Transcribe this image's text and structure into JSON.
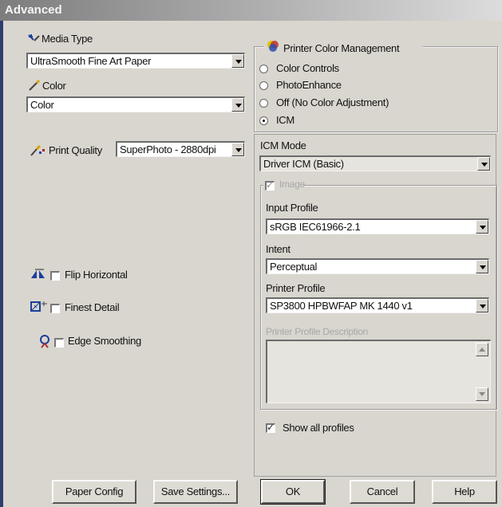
{
  "window": {
    "title": "Advanced"
  },
  "media_type": {
    "label": "Media Type",
    "value": "UltraSmooth Fine Art Paper",
    "icon": "media-type-icon"
  },
  "color": {
    "label": "Color",
    "value": "Color",
    "icon": "color-pen-icon"
  },
  "print_quality": {
    "label": "Print Quality",
    "value": "SuperPhoto - 2880dpi",
    "icon": "print-quality-icon"
  },
  "options": [
    {
      "label": "Flip Horizontal",
      "checked": false,
      "icon": "flip-horizontal-icon"
    },
    {
      "label": "Finest Detail",
      "checked": false,
      "icon": "finest-detail-icon"
    },
    {
      "label": "Edge Smoothing",
      "checked": false,
      "icon": "edge-smoothing-icon"
    }
  ],
  "color_management": {
    "title": "Printer Color Management",
    "options": [
      "Color Controls",
      "PhotoEnhance",
      "Off (No Color Adjustment)",
      "ICM"
    ],
    "selected": "ICM"
  },
  "icm": {
    "mode_label": "ICM Mode",
    "mode_value": "Driver ICM (Basic)",
    "image_label": "Image",
    "image_checked": true,
    "input_profile_label": "Input Profile",
    "input_profile_value": "sRGB IEC61966-2.1",
    "intent_label": "Intent",
    "intent_value": "Perceptual",
    "printer_profile_label": "Printer Profile",
    "printer_profile_value": "SP3800 HPBWFAP MK 1440 v1",
    "printer_profile_description_label": "Printer Profile Description",
    "show_all_profiles_label": "Show all profiles",
    "show_all_profiles_checked": true
  },
  "buttons": {
    "paper_config": "Paper Config",
    "save_settings": "Save Settings...",
    "ok": "OK",
    "cancel": "Cancel",
    "help": "Help"
  }
}
